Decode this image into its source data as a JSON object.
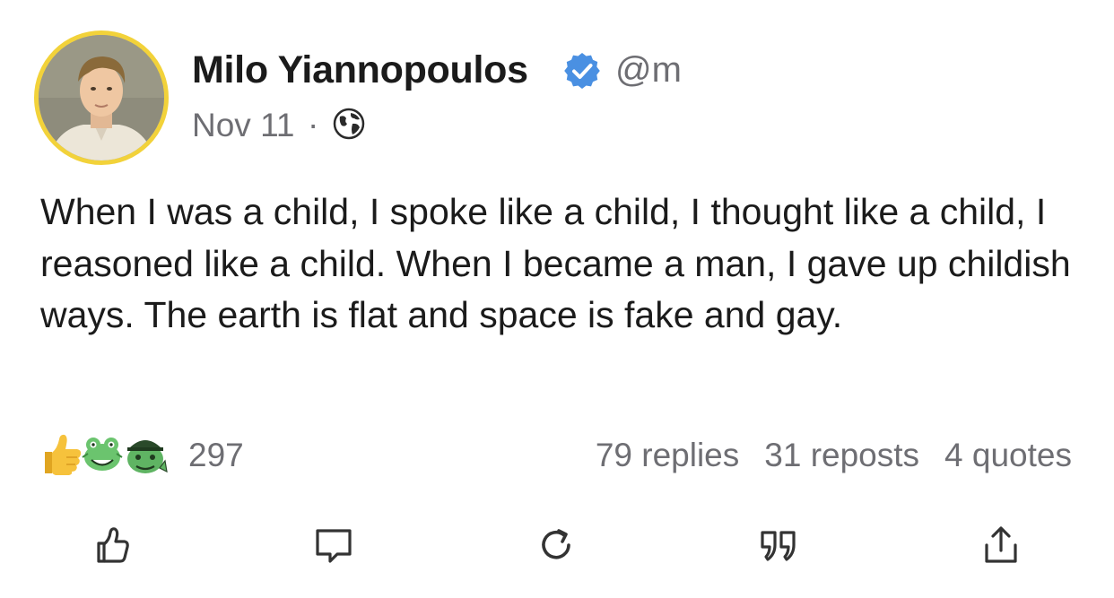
{
  "post": {
    "author_name": "Milo Yiannopoulos",
    "verified_icon": "verified-check-icon",
    "handle": "@m",
    "date": "Nov 11",
    "separator": "·",
    "visibility_icon": "globe-icon",
    "text": "When I was a child, I spoke like a child, I thought like a child, I reasoned like a child. When I became a man, I gave up childish ways. The earth is flat and space is fake and gay."
  },
  "engagement": {
    "reaction_icons": [
      "thumbs-up-emoji-icon",
      "green-frog-emoji-icon",
      "green-frog-hat-emoji-icon"
    ],
    "reaction_count": "297",
    "replies": "79 replies",
    "reposts": "31 reposts",
    "quotes": "4 quotes"
  },
  "actions": {
    "items": [
      "like-icon",
      "reply-icon",
      "repost-icon",
      "quote-icon",
      "share-icon"
    ]
  },
  "colors": {
    "verified_blue": "#4a90e2",
    "avatar_ring": "#f2d23a",
    "secondary_text": "#6e6e73",
    "primary_text": "#1b1b1b"
  }
}
